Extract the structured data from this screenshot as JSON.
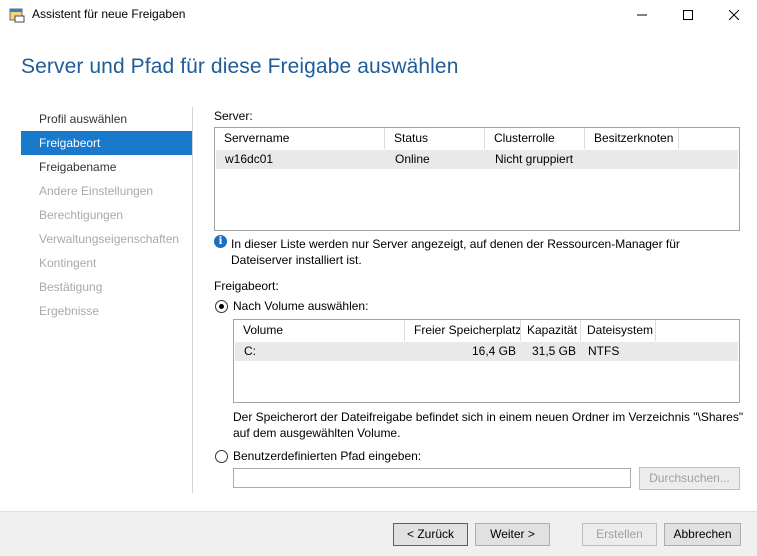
{
  "window": {
    "title": "Assistent für neue Freigaben"
  },
  "heading": "Server und Pfad für diese Freigabe auswählen",
  "nav": {
    "items": [
      {
        "label": "Profil auswählen",
        "state": "normal"
      },
      {
        "label": "Freigabeort",
        "state": "active"
      },
      {
        "label": "Freigabename",
        "state": "normal"
      },
      {
        "label": "Andere Einstellungen",
        "state": "disabled"
      },
      {
        "label": "Berechtigungen",
        "state": "disabled"
      },
      {
        "label": "Verwaltungseigenschaften",
        "state": "disabled"
      },
      {
        "label": "Kontingent",
        "state": "disabled"
      },
      {
        "label": "Bestätigung",
        "state": "disabled"
      },
      {
        "label": "Ergebnisse",
        "state": "disabled"
      }
    ]
  },
  "server": {
    "label": "Server:",
    "columns": [
      "Servername",
      "Status",
      "Clusterrolle",
      "Besitzerknoten"
    ],
    "rows": [
      {
        "name": "w16dc01",
        "status": "Online",
        "cluster_role": "Nicht gruppiert",
        "owner_node": ""
      }
    ]
  },
  "info_text": "In dieser Liste werden nur Server angezeigt, auf denen der Ressourcen-Manager für Dateiserver installiert ist.",
  "share_location": {
    "label": "Freigabeort:",
    "by_volume": {
      "label": "Nach Volume auswählen:",
      "selected": true,
      "columns": [
        "Volume",
        "Freier Speicherplatz",
        "Kapazität",
        "Dateisystem"
      ],
      "rows": [
        {
          "volume": "C:",
          "free_space": "16,4 GB",
          "capacity": "31,5 GB",
          "file_system": "NTFS"
        }
      ]
    },
    "description": "Der Speicherort der Dateifreigabe befindet sich in einem neuen Ordner im Verzeichnis \"\\Shares\" auf dem ausgewählten Volume.",
    "custom_path": {
      "label": "Benutzerdefinierten Pfad eingeben:",
      "selected": false,
      "value": "",
      "browse_label": "Durchsuchen..."
    }
  },
  "footer": {
    "back_label": "< Zurück",
    "next_label": "Weiter >",
    "create_label": "Erstellen",
    "cancel_label": "Abbrechen"
  },
  "colors": {
    "heading": "#1e5d99",
    "nav_active": "#1979ca",
    "info_icon": "#1a6fc0"
  }
}
